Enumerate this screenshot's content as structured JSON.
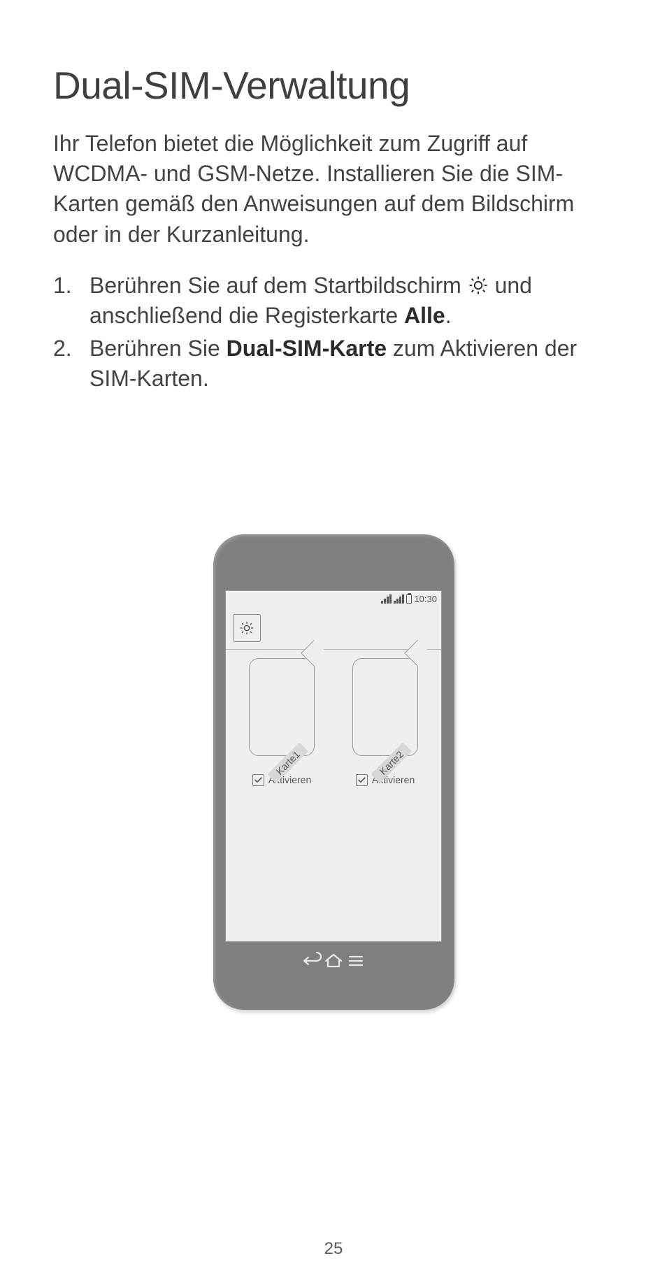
{
  "title": "Dual-SIM-Verwaltung",
  "intro": "Ihr Telefon bietet die Möglichkeit zum Zugriff auf WCDMA- und GSM-Netze. Installieren Sie die SIM-Karten gemäß den Anweisungen auf dem Bildschirm oder in der Kurzanleitung.",
  "steps": {
    "s1_a": "Berühren Sie auf dem Startbildschirm ",
    "s1_b": " und anschließend die Registerkarte ",
    "s1_bold": "Alle",
    "s1_c": ".",
    "s2_a": "Berühren Sie ",
    "s2_bold": "Dual-SIM-Karte",
    "s2_b": " zum Aktivieren der SIM-Karten."
  },
  "phone": {
    "time": "10:30",
    "sim1": {
      "label": "Karte1",
      "activate": "Aktivieren"
    },
    "sim2": {
      "label": "Karte2",
      "activate": "Aktivieren"
    }
  },
  "page_number": "25"
}
